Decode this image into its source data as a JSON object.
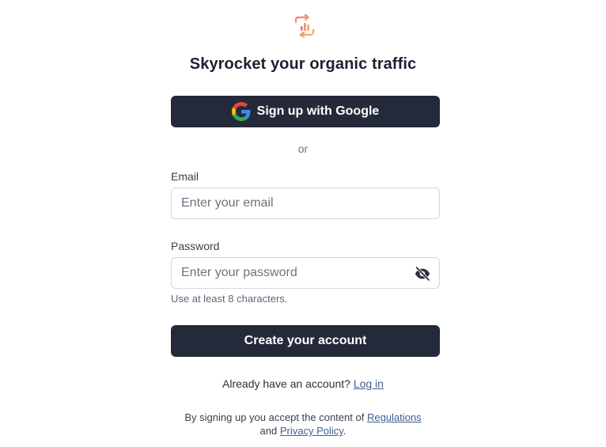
{
  "brand": {
    "logo_icon": "chart-refresh-logo-icon",
    "logo_colors": [
      "#f06a8a",
      "#f5a35f",
      "#f7c25a"
    ]
  },
  "heading": "Skyrocket your organic traffic",
  "google_button": {
    "label": "Sign up with Google",
    "icon": "google-g-icon"
  },
  "divider_text": "or",
  "email": {
    "label": "Email",
    "placeholder": "Enter your email",
    "value": ""
  },
  "password": {
    "label": "Password",
    "placeholder": "Enter your password",
    "value": "",
    "toggle_icon": "eye-slash-icon",
    "hint": "Use at least 8 characters."
  },
  "create_button": {
    "label": "Create your account"
  },
  "login_prompt": {
    "text": "Already have an account?",
    "link": "Log in"
  },
  "terms": {
    "prefix": "By signing up you accept the content of",
    "regulations": "Regulations",
    "and": "and",
    "privacy": "Privacy Policy",
    "suffix": "."
  },
  "colors": {
    "button_bg": "#242a39",
    "link": "#3f5f8f",
    "border": "#d4d7dd"
  }
}
